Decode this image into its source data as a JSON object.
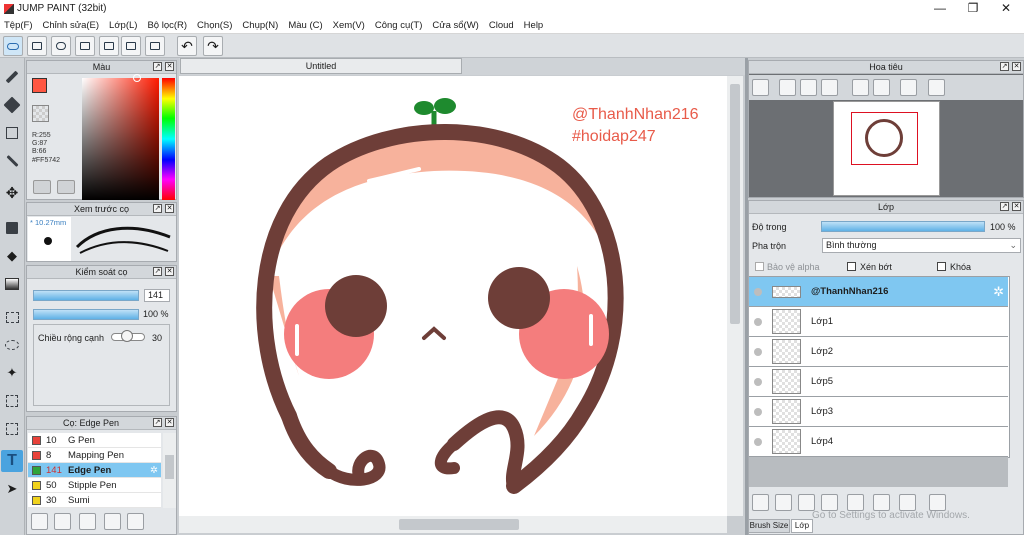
{
  "window": {
    "title": "JUMP PAINT (32bit)",
    "minimize": "—",
    "restore": "❐",
    "close": "✕"
  },
  "menu": [
    "Tệp(F)",
    "Chỉnh sửa(E)",
    "Lớp(L)",
    "Bộ lọc(R)",
    "Chọn(S)",
    "Chụp(N)",
    "Màu (C)",
    "Xem(V)",
    "Công cụ(T)",
    "Cửa sổ(W)",
    "Cloud",
    "Help"
  ],
  "panels": {
    "color": {
      "title": "Màu",
      "r": "R:255",
      "g": "G:87",
      "b": "B:66",
      "hex": "#FF5742",
      "current": "#ff5742"
    },
    "brush_preview": {
      "title": "Xem trước cọ",
      "size": "10.27mm"
    },
    "brush_control": {
      "title": "Kiểm soát cọ",
      "size_value": "141",
      "opacity_value": "100 %",
      "edge_label": "Chiều rộng cạnh",
      "edge_value": "30"
    },
    "brush_list": {
      "title": "Cọ: Edge Pen",
      "items": [
        {
          "size": "10",
          "name": "G Pen",
          "color": "#e8423a"
        },
        {
          "size": "8",
          "name": "Mapping Pen",
          "color": "#e8423a"
        },
        {
          "size": "141",
          "name": "Edge Pen",
          "color": "#2fa43a"
        },
        {
          "size": "50",
          "name": "Stipple Pen",
          "color": "#f0d21c"
        },
        {
          "size": "30",
          "name": "Sumi",
          "color": "#f0d21c"
        }
      ]
    },
    "navigator": {
      "title": "Hoa tiêu"
    },
    "layers": {
      "title": "Lớp",
      "opacity_label": "Độ trong",
      "opacity_value": "100 %",
      "blend_label": "Pha trộn",
      "blend_value": "Bình thường",
      "protect_alpha": "Bảo vệ alpha",
      "clipping": "Xén bớt",
      "lock": "Khóa",
      "items": [
        "@ThanhNhan216",
        "Lớp1",
        "Lớp2",
        "Lớp5",
        "Lớp3",
        "Lớp4"
      ]
    }
  },
  "document": {
    "tab": "Untitled"
  },
  "canvas_text": {
    "line1": "@ThanhNhan216",
    "line2": "#hoidap247"
  },
  "bottom_tabs": [
    "Brush Size",
    "Lớp"
  ],
  "watermark": "Go to Settings to activate Windows."
}
